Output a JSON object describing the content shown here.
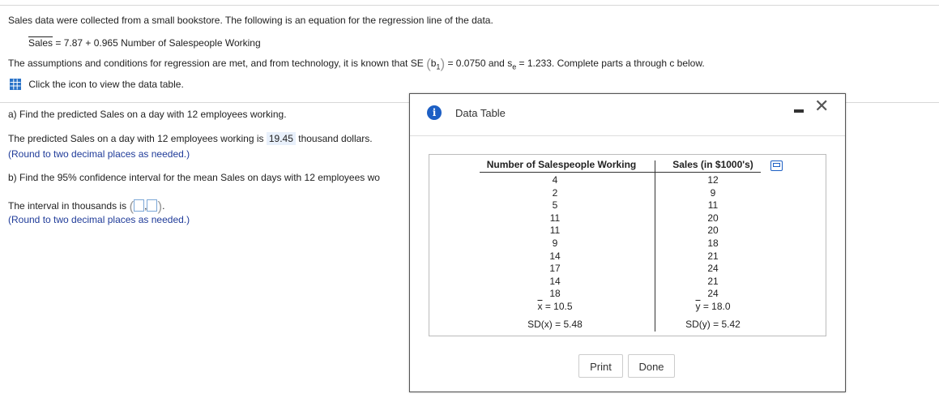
{
  "intro": "Sales data were collected from a small bookstore. The following is an equation for the regression line of the data.",
  "equation": {
    "response_hat": "Sales",
    "rest": " = 7.87 + 0.965 Number of Salespeople Working"
  },
  "assumptions": {
    "before": "The assumptions and conditions for regression are met, and from technology, it is known that SE",
    "b1": "b",
    "b1_sub": "1",
    "middle": " = 0.0750 and s",
    "se_sub": "e",
    "after": " = 1.233. Complete parts a through c below."
  },
  "data_table_link": "Click the icon to view the data table.",
  "part_a": {
    "question": "a) Find the predicted Sales on a day with 12 employees working.",
    "answer_prefix": "The predicted Sales on a day with 12 employees working is",
    "answer_value": "19.45",
    "answer_suffix": "thousand dollars.",
    "hint": "(Round to two decimal places as needed.)"
  },
  "part_b": {
    "question": "b) Find the 95% confidence interval for the mean Sales on days with 12 employees wo",
    "interval_prefix": "The interval in thousands is",
    "interval_comma": ",",
    "interval_end": ".",
    "hint": "(Round to two decimal places as needed.)"
  },
  "modal": {
    "title": "Data Table",
    "info_glyph": "i",
    "close_glyph": "✕",
    "col1_header": "Number of Salespeople Working",
    "col2_header": "Sales (in $1000's)",
    "col1_values": [
      "4",
      "2",
      "5",
      "11",
      "11",
      "9",
      "14",
      "17",
      "14",
      "18"
    ],
    "col2_values": [
      "12",
      "9",
      "11",
      "20",
      "20",
      "18",
      "21",
      "24",
      "21",
      "24"
    ],
    "x_mean_label": "x",
    "x_mean_value": " = 10.5",
    "x_sd": "SD(x) = 5.48",
    "y_mean_label": "y",
    "y_mean_value": " = 18.0",
    "y_sd": "SD(y) = 5.42",
    "print_label": "Print",
    "done_label": "Done"
  }
}
